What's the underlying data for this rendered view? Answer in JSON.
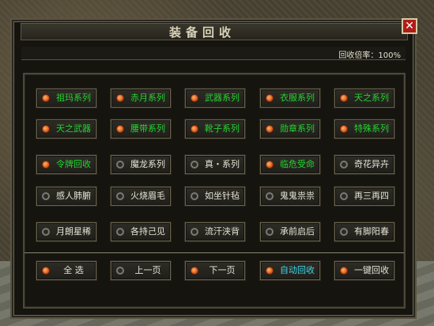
{
  "window": {
    "title": "装备回收",
    "close_icon": "close-icon",
    "close_glyph": "✕"
  },
  "rate": {
    "label": "回收倍率：100%"
  },
  "colors": {
    "green": "#22d430",
    "white": "#e5e2d6",
    "cyan": "#3fd6e6"
  },
  "grid": [
    [
      {
        "label": "祖玛系列",
        "on": true,
        "color": "green"
      },
      {
        "label": "赤月系列",
        "on": true,
        "color": "green"
      },
      {
        "label": "武器系列",
        "on": true,
        "color": "green"
      },
      {
        "label": "衣服系列",
        "on": true,
        "color": "green"
      },
      {
        "label": "天之系列",
        "on": true,
        "color": "green"
      }
    ],
    [
      {
        "label": "天之武器",
        "on": true,
        "color": "green"
      },
      {
        "label": "腰带系列",
        "on": true,
        "color": "green"
      },
      {
        "label": "靴子系列",
        "on": true,
        "color": "green"
      },
      {
        "label": "勋章系列",
        "on": true,
        "color": "green"
      },
      {
        "label": "特殊系列",
        "on": true,
        "color": "green"
      }
    ],
    [
      {
        "label": "令牌回收",
        "on": true,
        "color": "green"
      },
      {
        "label": "魔龙系列",
        "on": false,
        "color": "white"
      },
      {
        "label": "真・系列",
        "on": false,
        "color": "white"
      },
      {
        "label": "临危受命",
        "on": true,
        "color": "green"
      },
      {
        "label": "奇花异卉",
        "on": false,
        "color": "white"
      }
    ],
    [
      {
        "label": "感人肺腑",
        "on": false,
        "color": "white"
      },
      {
        "label": "火烧眉毛",
        "on": false,
        "color": "white"
      },
      {
        "label": "如坐针毡",
        "on": false,
        "color": "white"
      },
      {
        "label": "鬼鬼祟祟",
        "on": false,
        "color": "white"
      },
      {
        "label": "再三再四",
        "on": false,
        "color": "white"
      }
    ],
    [
      {
        "label": "月朗星稀",
        "on": false,
        "color": "white"
      },
      {
        "label": "各持己见",
        "on": false,
        "color": "white"
      },
      {
        "label": "流汗浃背",
        "on": false,
        "color": "white"
      },
      {
        "label": "承前启后",
        "on": false,
        "color": "white"
      },
      {
        "label": "有脚阳春",
        "on": false,
        "color": "white"
      }
    ]
  ],
  "actions": [
    {
      "label": "全  选",
      "on": true,
      "color": "white",
      "name": "select-all-button"
    },
    {
      "label": "上一页",
      "on": false,
      "color": "white",
      "name": "prev-page-button"
    },
    {
      "label": "下一页",
      "on": true,
      "color": "white",
      "name": "next-page-button"
    },
    {
      "label": "自动回收",
      "on": true,
      "color": "cyan",
      "name": "auto-recycle-button"
    },
    {
      "label": "一键回收",
      "on": true,
      "color": "white",
      "name": "one-click-recycle-button"
    }
  ]
}
